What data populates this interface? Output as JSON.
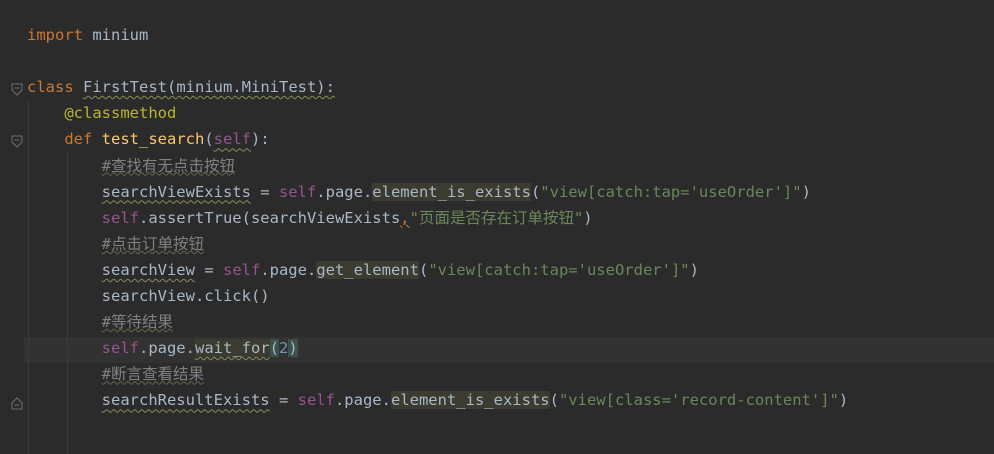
{
  "editor": {
    "lines": [
      {
        "segments": [
          {
            "t": "import",
            "c": "kw"
          },
          {
            "t": " minium",
            "c": "plain"
          }
        ]
      },
      {
        "segments": []
      },
      {
        "segments": [
          {
            "t": "class",
            "c": "kw"
          },
          {
            "t": " ",
            "c": "plain"
          },
          {
            "t": "FirstTest(minium.MiniTest):",
            "c": "plain ul-wavy"
          }
        ]
      },
      {
        "segments": [
          {
            "t": "    ",
            "c": "plain"
          },
          {
            "t": "@classmethod",
            "c": "dec"
          }
        ]
      },
      {
        "segments": [
          {
            "t": "    ",
            "c": "plain"
          },
          {
            "t": "def",
            "c": "kw"
          },
          {
            "t": " ",
            "c": "plain"
          },
          {
            "t": "test_search",
            "c": "fn"
          },
          {
            "t": "(",
            "c": "plain"
          },
          {
            "t": "self",
            "c": "self ul-wavy"
          },
          {
            "t": "):",
            "c": "plain"
          }
        ]
      },
      {
        "segments": [
          {
            "t": "        ",
            "c": "plain"
          },
          {
            "t": "#查找有无点击按钮",
            "c": "cmt"
          }
        ]
      },
      {
        "segments": [
          {
            "t": "        ",
            "c": "plain"
          },
          {
            "t": "searchViewExists",
            "c": "plain ul-wavy"
          },
          {
            "t": " = ",
            "c": "plain"
          },
          {
            "t": "self",
            "c": "self"
          },
          {
            "t": ".page.",
            "c": "plain"
          },
          {
            "t": "element_is_exists",
            "c": "plain hl-method"
          },
          {
            "t": "(",
            "c": "plain"
          },
          {
            "t": "\"view[catch:tap='useOrder']\"",
            "c": "str"
          },
          {
            "t": ")",
            "c": "plain"
          }
        ]
      },
      {
        "segments": [
          {
            "t": "        ",
            "c": "plain"
          },
          {
            "t": "self",
            "c": "self"
          },
          {
            "t": ".assertTrue(searchViewExists",
            "c": "plain"
          },
          {
            "t": ",",
            "c": "kw warn-comma"
          },
          {
            "t": "\"页面是否存在订单按钮\"",
            "c": "str"
          },
          {
            "t": ")",
            "c": "plain"
          }
        ]
      },
      {
        "segments": [
          {
            "t": "        ",
            "c": "plain"
          },
          {
            "t": "#点击订单按钮",
            "c": "cmt"
          }
        ]
      },
      {
        "segments": [
          {
            "t": "        ",
            "c": "plain"
          },
          {
            "t": "searchView",
            "c": "plain ul-wavy"
          },
          {
            "t": " = ",
            "c": "plain"
          },
          {
            "t": "self",
            "c": "self"
          },
          {
            "t": ".page.",
            "c": "plain"
          },
          {
            "t": "get_element",
            "c": "plain hl-method"
          },
          {
            "t": "(",
            "c": "plain"
          },
          {
            "t": "\"view[catch:tap='useOrder']\"",
            "c": "str"
          },
          {
            "t": ")",
            "c": "plain"
          }
        ]
      },
      {
        "segments": [
          {
            "t": "        ",
            "c": "plain"
          },
          {
            "t": "searchView.click()",
            "c": "plain"
          }
        ]
      },
      {
        "segments": [
          {
            "t": "        ",
            "c": "plain"
          },
          {
            "t": "#等待结果",
            "c": "cmt"
          }
        ]
      },
      {
        "segments": [
          {
            "t": "        ",
            "c": "plain"
          },
          {
            "t": "self",
            "c": "self"
          },
          {
            "t": ".page.",
            "c": "plain"
          },
          {
            "t": "wait_for",
            "c": "plain hl-method ul-wavy"
          },
          {
            "t": "(",
            "c": "plain paren-match"
          },
          {
            "t": "2",
            "c": "num"
          },
          {
            "t": ")",
            "c": "plain paren-match"
          }
        ]
      },
      {
        "segments": [
          {
            "t": "        ",
            "c": "plain"
          },
          {
            "t": "#断言查看结果",
            "c": "cmt"
          }
        ]
      },
      {
        "segments": [
          {
            "t": "        ",
            "c": "plain"
          },
          {
            "t": "searchResultExists",
            "c": "plain ul-wavy"
          },
          {
            "t": " = ",
            "c": "plain"
          },
          {
            "t": "self",
            "c": "self"
          },
          {
            "t": ".page.",
            "c": "plain"
          },
          {
            "t": "element_is_exists",
            "c": "plain hl-method"
          },
          {
            "t": "(",
            "c": "plain"
          },
          {
            "t": "\"view[class='record-content']\"",
            "c": "str"
          },
          {
            "t": ")",
            "c": "plain"
          }
        ]
      }
    ]
  },
  "colors": {
    "background": "#2b2b2b",
    "keyword": "#cc7832",
    "function": "#ffc66d",
    "self": "#94558d",
    "string": "#6a8759",
    "comment": "#808080",
    "decorator": "#bbb529",
    "number": "#6897bb",
    "text": "#a9b7c6"
  },
  "icons": [
    "fold-open-icon",
    "fold-open-icon",
    "fold-close-icon"
  ]
}
